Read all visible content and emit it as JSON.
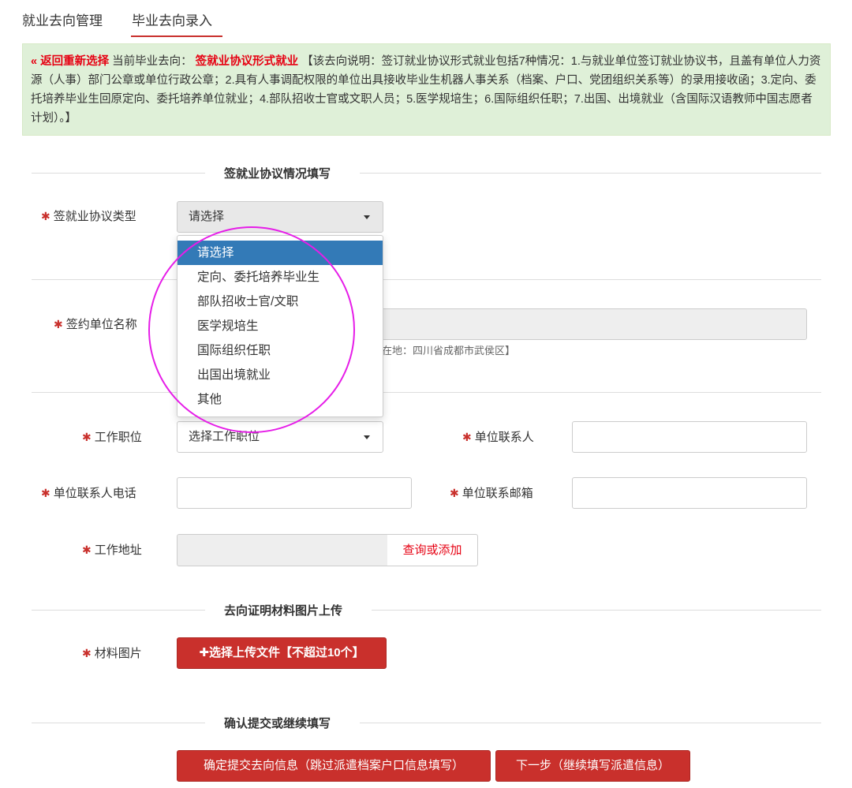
{
  "tabs": [
    {
      "label": "就业去向管理"
    },
    {
      "label": "毕业去向录入"
    }
  ],
  "notice": {
    "back_link": "« 返回重新选择",
    "current_prefix": "当前毕业去向：",
    "current_value": "签就业协议形式就业",
    "description": "【该去向说明：签订就业协议形式就业包括7种情况：1.与就业单位签订就业协议书，且盖有单位人力资源（人事）部门公章或单位行政公章；2.具有人事调配权限的单位出具接收毕业生机器人事关系（档案、户口、党团组织关系等）的录用接收函；3.定向、委托培养毕业生回原定向、委托培养单位就业；4.部队招收士官或文职人员；5.医学规培生；6.国际组织任职；7.出国、出境就业（含国际汉语教师中国志愿者计划）。】"
  },
  "sections": {
    "agreement": "签就业协议情况填写",
    "upload": "去向证明材料图片上传",
    "confirm": "确认提交或继续填写"
  },
  "form": {
    "agreement_type_label": "签就业协议类型",
    "agreement_type_value": "请选择",
    "employer_label": "签约单位名称",
    "employer_hint": "在地：四川省成都市武侯区】",
    "position_label": "工作职位",
    "position_value": "选择工作职位",
    "contact_label": "单位联系人",
    "contact_phone_label": "单位联系人电话",
    "contact_email_label": "单位联系邮箱",
    "address_label": "工作地址",
    "address_button": "查询或添加",
    "material_label": "材料图片",
    "upload_button": "选择上传文件【不超过10个】"
  },
  "dropdown": {
    "options": [
      "请选择",
      "定向、委托培养毕业生",
      "部队招收士官/文职",
      "医学规培生",
      "国际组织任职",
      "出国出境就业",
      "其他"
    ],
    "selected_index": 0
  },
  "buttons": {
    "submit": "确定提交去向信息（跳过派遣档案户口信息填写）",
    "next": "下一步（继续填写派遣信息）"
  },
  "colors": {
    "accent": "#c9302c",
    "notice_bg": "#dff0d8",
    "highlight": "#e60012",
    "selected": "#337ab7",
    "annotation_circle": "#e61de8"
  }
}
